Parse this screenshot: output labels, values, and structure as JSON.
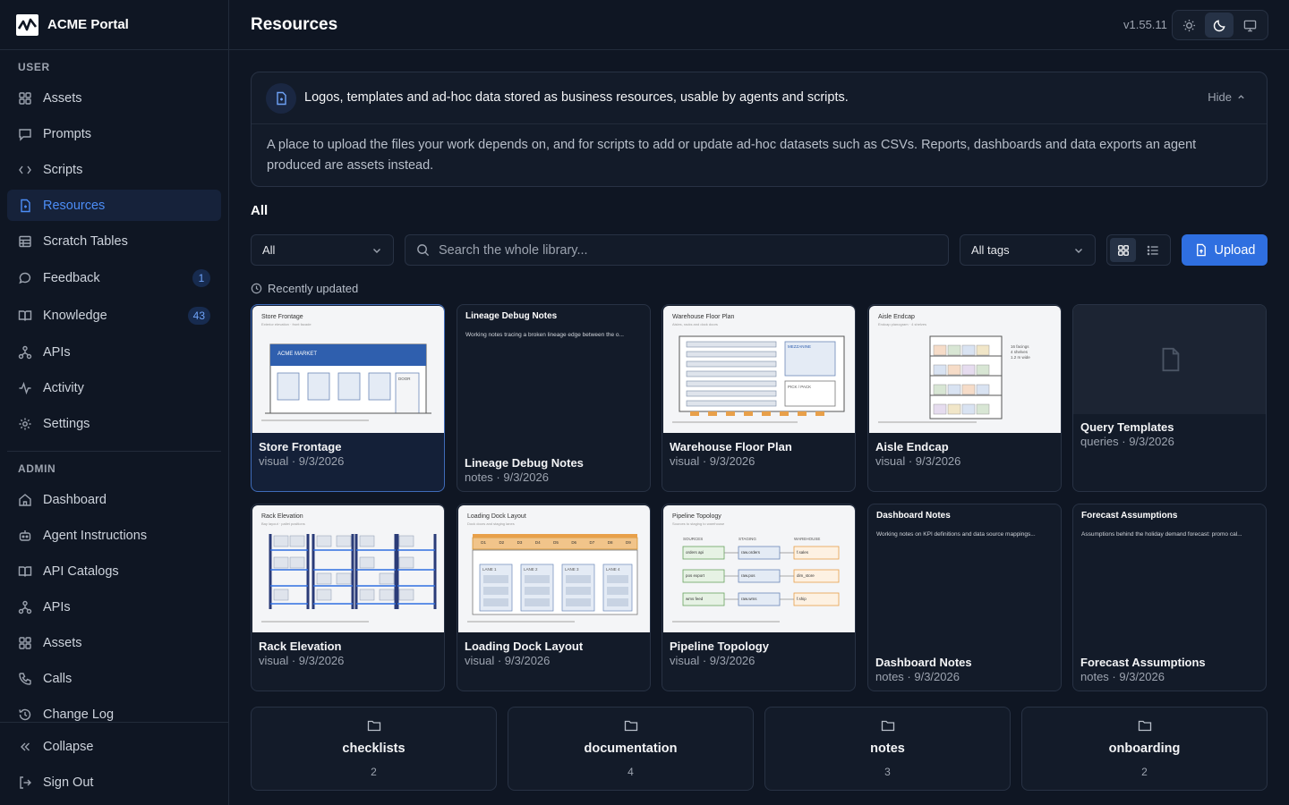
{
  "app": {
    "name": "ACME Portal",
    "version": "v1.55.11"
  },
  "sidebar": {
    "user_label": "USER",
    "user_items": [
      {
        "label": "Assets"
      },
      {
        "label": "Prompts"
      },
      {
        "label": "Scripts"
      },
      {
        "label": "Resources"
      },
      {
        "label": "Scratch Tables"
      },
      {
        "label": "Feedback",
        "badge": "1"
      },
      {
        "label": "Knowledge",
        "badge": "43"
      },
      {
        "label": "APIs"
      },
      {
        "label": "Activity"
      },
      {
        "label": "Settings"
      }
    ],
    "admin_label": "ADMIN",
    "admin_items": [
      {
        "label": "Dashboard"
      },
      {
        "label": "Agent Instructions"
      },
      {
        "label": "API Catalogs"
      },
      {
        "label": "APIs"
      },
      {
        "label": "Assets"
      },
      {
        "label": "Calls"
      },
      {
        "label": "Change Log"
      }
    ],
    "collapse": "Collapse",
    "sign_out": "Sign Out"
  },
  "header": {
    "title": "Resources"
  },
  "info": {
    "title": "Logos, templates and ad-hoc data stored as business resources, usable by agents and scripts.",
    "hide": "Hide",
    "body": "A place to upload the files your work depends on, and for scripts to add or update ad-hoc datasets such as CSVs. Reports, dashboards and data exports an agent produced are assets instead."
  },
  "section": {
    "title": "All"
  },
  "toolbar": {
    "type_filter": "All",
    "search_placeholder": "Search the whole library...",
    "tags_filter": "All tags",
    "upload": "Upload"
  },
  "recent": {
    "label": "Recently updated"
  },
  "cards": [
    {
      "name": "Store Frontage",
      "meta": "visual · 9/3/2026",
      "thumb_title": "Store Frontage",
      "thumb_sub": "Exterior elevation · front facade",
      "thumb_text": "ACME MARKET",
      "thumb_text2": "DOOR"
    },
    {
      "name": "Lineage Debug Notes",
      "meta": "notes · 9/3/2026",
      "note_title": "Lineage Debug Notes",
      "snippet": "Working notes tracing a broken lineage edge between the o..."
    },
    {
      "name": "Warehouse Floor Plan",
      "meta": "visual · 9/3/2026",
      "thumb_title": "Warehouse Floor Plan",
      "thumb_sub": "Aisles, racks and dock doors",
      "zone1": "MEZZANINE",
      "zone2": "PICK / PACK"
    },
    {
      "name": "Aisle Endcap",
      "meta": "visual · 9/3/2026",
      "thumb_title": "Aisle Endcap",
      "thumb_sub": "Endcap planogram · 4 shelves",
      "facings": "16 facings",
      "shelves": "4 shelves",
      "width": "1.2 m wide"
    },
    {
      "name": "Query Templates",
      "meta": "queries · 9/3/2026"
    },
    {
      "name": "Rack Elevation",
      "meta": "visual · 9/3/2026",
      "thumb_title": "Rack Elevation",
      "thumb_sub": "Bay layout · pallet positions"
    },
    {
      "name": "Loading Dock Layout",
      "meta": "visual · 9/3/2026",
      "thumb_title": "Loading Dock Layout",
      "thumb_sub": "Dock doors and staging lanes",
      "doors": [
        "D1",
        "D2",
        "D3",
        "D4",
        "D5",
        "D6",
        "D7",
        "D8",
        "D9"
      ],
      "lanes": [
        "LANE 1",
        "LANE 2",
        "LANE 3",
        "LANE 4"
      ]
    },
    {
      "name": "Pipeline Topology",
      "meta": "visual · 9/3/2026",
      "thumb_title": "Pipeline Topology",
      "thumb_sub": "Sources to staging to warehouse",
      "cols": [
        "SOURCES",
        "STAGING",
        "WAREHOUSE"
      ],
      "sources": [
        "orders api",
        "pos export",
        "wms feed"
      ],
      "staging": [
        "raw.orders",
        "raw.pos",
        "raw.wms"
      ],
      "warehouse": [
        "f.sales",
        "dim_store",
        "f.ship"
      ]
    },
    {
      "name": "Dashboard Notes",
      "meta": "notes · 9/3/2026",
      "note_title": "Dashboard Notes",
      "snippet": "Working notes on KPI definitions and data source mappings..."
    },
    {
      "name": "Forecast Assumptions",
      "meta": "notes · 9/3/2026",
      "note_title": "Forecast Assumptions",
      "snippet": "Assumptions behind the holiday demand forecast: promo cal..."
    }
  ],
  "folders": [
    {
      "name": "checklists",
      "count": "2"
    },
    {
      "name": "documentation",
      "count": "4"
    },
    {
      "name": "notes",
      "count": "3"
    },
    {
      "name": "onboarding",
      "count": "2"
    }
  ],
  "colors": {
    "accent": "#2f6fe0",
    "active_text": "#4c8df6",
    "background": "#0f1623",
    "card": "#131b29",
    "border": "#283244"
  }
}
